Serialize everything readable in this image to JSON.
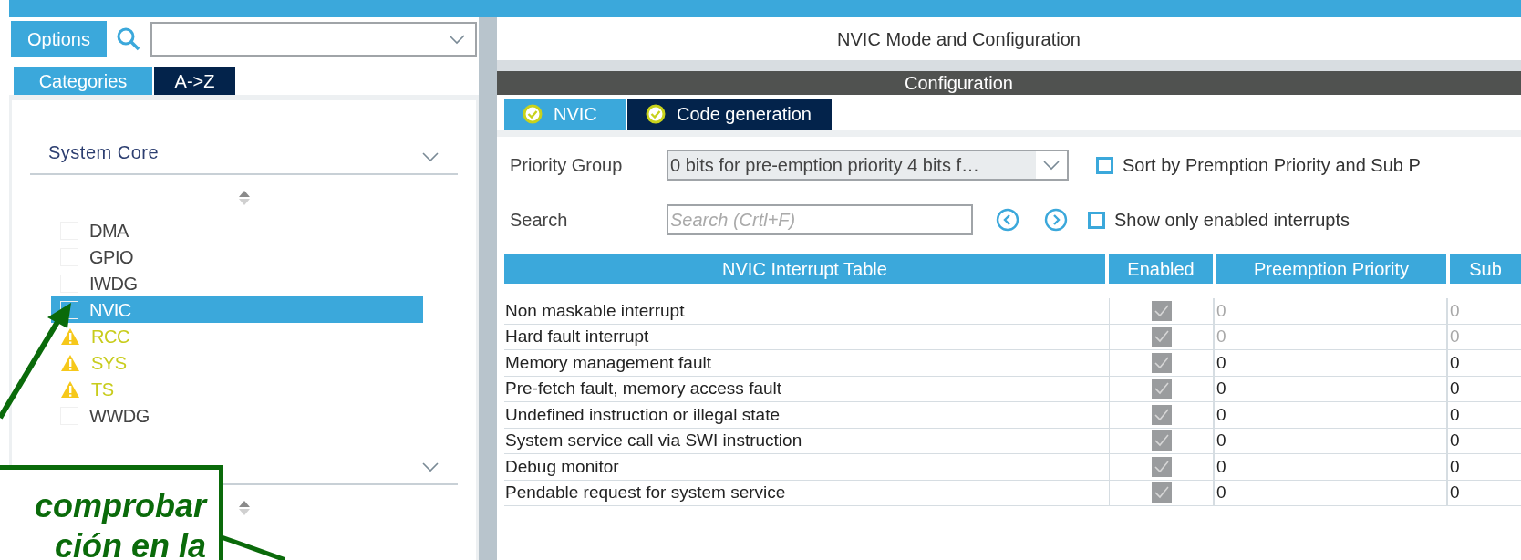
{
  "sidebar": {
    "options_button": "Options",
    "view_tabs": [
      {
        "label": "Categories",
        "selected": true
      },
      {
        "label": "A->Z",
        "selected": false
      }
    ],
    "categories": [
      {
        "title": "System Core",
        "expanded": true,
        "items": [
          {
            "label": "DMA",
            "warning": false,
            "selected": false
          },
          {
            "label": "GPIO",
            "warning": false,
            "selected": false
          },
          {
            "label": "IWDG",
            "warning": false,
            "selected": false
          },
          {
            "label": "NVIC",
            "warning": false,
            "selected": true
          },
          {
            "label": "RCC",
            "warning": true,
            "selected": false
          },
          {
            "label": "SYS",
            "warning": true,
            "selected": false
          },
          {
            "label": "TS",
            "warning": true,
            "selected": false
          },
          {
            "label": "WWDG",
            "warning": false,
            "selected": false
          }
        ]
      },
      {
        "expanded": true
      }
    ]
  },
  "main": {
    "title": "NVIC Mode and Configuration",
    "section": "Configuration",
    "tabs": [
      {
        "label": "NVIC",
        "selected": true
      },
      {
        "label": "Code generation",
        "selected": false
      }
    ],
    "priority_group": {
      "label": "Priority Group",
      "value": "0 bits for pre-emption priority 4 bits f…"
    },
    "search": {
      "label": "Search",
      "placeholder": "Search (Crtl+F)"
    },
    "options": [
      {
        "label": "Sort by Premption Priority and Sub P",
        "checked": false
      },
      {
        "label": "Show only enabled interrupts",
        "checked": false
      }
    ],
    "table": {
      "columns": [
        "NVIC Interrupt Table",
        "Enabled",
        "Preemption Priority",
        "Sub"
      ],
      "rows": [
        {
          "name": "Non maskable interrupt",
          "enabled": true,
          "disabled": true,
          "preemption": "0",
          "sub": "0"
        },
        {
          "name": "Hard fault interrupt",
          "enabled": true,
          "disabled": true,
          "preemption": "0",
          "sub": "0"
        },
        {
          "name": "Memory management fault",
          "enabled": true,
          "disabled": false,
          "preemption": "0",
          "sub": "0"
        },
        {
          "name": "Pre-fetch fault, memory access fault",
          "enabled": true,
          "disabled": false,
          "preemption": "0",
          "sub": "0"
        },
        {
          "name": "Undefined instruction or illegal state",
          "enabled": true,
          "disabled": false,
          "preemption": "0",
          "sub": "0"
        },
        {
          "name": "System service call via SWI instruction",
          "enabled": true,
          "disabled": false,
          "preemption": "0",
          "sub": "0"
        },
        {
          "name": "Debug monitor",
          "enabled": true,
          "disabled": false,
          "preemption": "0",
          "sub": "0"
        },
        {
          "name": "Pendable request for system service",
          "enabled": true,
          "disabled": false,
          "preemption": "0",
          "sub": "0"
        }
      ]
    }
  },
  "callout": {
    "lines": [
      "comprobar",
      "ción en la"
    ]
  }
}
